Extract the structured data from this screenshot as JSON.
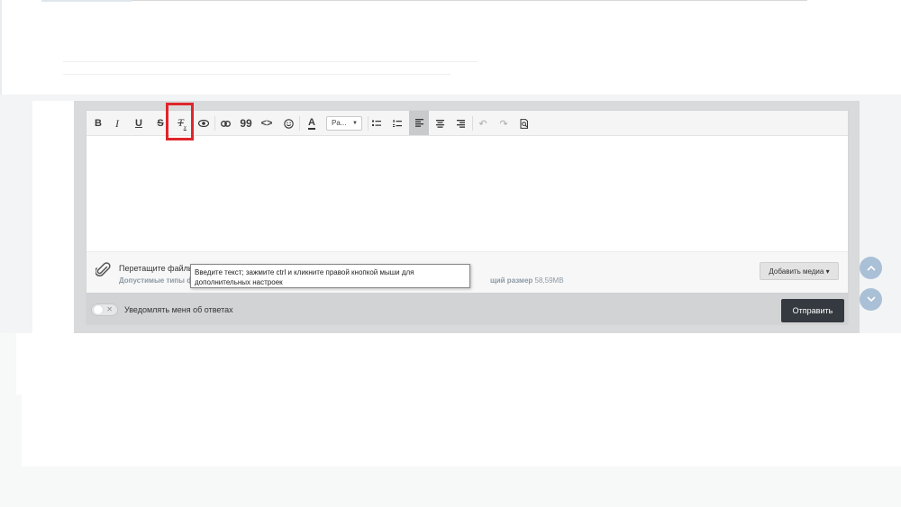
{
  "toolbar": {
    "bold_label": "B",
    "italic_label": "I",
    "underline_label": "U",
    "strike_label": "S",
    "clear_format_label": "T",
    "clear_format_sub": "x",
    "quote_label": "99",
    "code_label": "<>",
    "font_color_label": "A",
    "paragraph_select": "Pa...",
    "icons": [
      "bold-icon",
      "italic-icon",
      "underline-icon",
      "strikethrough-icon",
      "clear-formatting-icon",
      "eye-icon",
      "link-icon",
      "quote-icon",
      "code-icon",
      "emoji-icon",
      "font-color-icon",
      "bullet-list-icon",
      "numbered-list-icon",
      "align-left-icon",
      "align-center-icon",
      "align-right-icon",
      "undo-icon",
      "redo-icon",
      "preview-icon"
    ]
  },
  "dropzone": {
    "title": "Перетащите файлы",
    "types_label": "Допустимые типы ф",
    "max_size_label": "щий размер",
    "max_size_value": "58,59MB",
    "add_media_label": "Добавить медиа ▾"
  },
  "tooltip": {
    "text": "Введите текст; зажмите ctrl и кликните правой кнопкой мыши для дополнительных настроек"
  },
  "footer": {
    "notify_label": "Уведомлять меня об ответах",
    "submit_label": "Отправить"
  },
  "scroll": {
    "up_icon": "chevron-up-icon",
    "down_icon": "chevron-down-icon"
  },
  "colors": {
    "highlight": "#e0252b",
    "submit_bg": "#343a40",
    "scroll_btn": "#a9c0d6"
  }
}
